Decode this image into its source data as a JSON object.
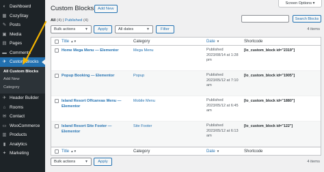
{
  "sidebar": {
    "items": [
      {
        "label": "Dashboard",
        "icon": "dashboard-icon",
        "glyph": "◐"
      },
      {
        "label": "CozyStay",
        "icon": "cozystay-icon",
        "glyph": "▦"
      },
      {
        "label": "Posts",
        "icon": "posts-icon",
        "glyph": "✎"
      },
      {
        "label": "Media",
        "icon": "media-icon",
        "glyph": "▣"
      },
      {
        "label": "Pages",
        "icon": "pages-icon",
        "glyph": "▤"
      },
      {
        "label": "Comments",
        "icon": "comments-icon",
        "glyph": "▬"
      },
      {
        "label": "Custom Blocks",
        "icon": "custom-blocks-icon",
        "glyph": "✈"
      }
    ],
    "submenu": [
      {
        "label": "All Custom Blocks"
      },
      {
        "label": "Add New"
      },
      {
        "label": "Category"
      }
    ],
    "items_after": [
      {
        "label": "Header Builder",
        "icon": "header-builder-icon",
        "glyph": "✈"
      },
      {
        "label": "Rooms",
        "icon": "rooms-icon",
        "glyph": "⌂"
      },
      {
        "label": "Contact",
        "icon": "contact-icon",
        "glyph": "✉"
      },
      {
        "label": "WooCommerce",
        "icon": "woocommerce-icon",
        "glyph": "▭"
      },
      {
        "label": "Products",
        "icon": "products-icon",
        "glyph": "▥"
      },
      {
        "label": "Analytics",
        "icon": "analytics-icon",
        "glyph": "▮"
      },
      {
        "label": "Marketing",
        "icon": "marketing-icon",
        "glyph": "✦"
      }
    ]
  },
  "header": {
    "screen_options": "Screen Options ▾",
    "title": "Custom Blocks",
    "add_new": "Add New"
  },
  "filters": {
    "all": "All",
    "all_count": "(4)",
    "sep": " | ",
    "published": "Published",
    "published_count": "(4)",
    "search_button": "Search Blocks",
    "bulk_actions": "Bulk actions",
    "apply": "Apply",
    "all_dates": "All dates",
    "filter": "Filter",
    "items_count": "4 items"
  },
  "table": {
    "headers": {
      "title": "Title",
      "category": "Category",
      "date": "Date",
      "shortcode": "Shortcode"
    },
    "rows": [
      {
        "title": "Home Mega Menu — Elementor",
        "category": "Mega Menu",
        "date_status": "Published",
        "date_value": "2023/08/14 at 1:28 pm",
        "shortcode": "[lo_custom_block id=\"2319\"]"
      },
      {
        "title": "Popup Booking — Elementor",
        "category": "Popup",
        "date_status": "Published",
        "date_value": "2023/05/12 at 7:10 am",
        "shortcode": "[lo_custom_block id=\"1905\"]"
      },
      {
        "title": "Island Resort Offcanvas Menu — Elementor",
        "category": "Mobile Menu",
        "date_status": "Published",
        "date_value": "2023/05/12 at 6:45 am",
        "shortcode": "[lo_custom_block id=\"1880\"]"
      },
      {
        "title": "Island Resort Site Footer — Elementor",
        "category": "Site Footer",
        "date_status": "Published",
        "date_value": "2023/05/12 at 6:13 am",
        "shortcode": "[lo_custom_block id=\"122\"]"
      }
    ]
  },
  "colors": {
    "sidebar": "#1d2327",
    "active": "#2271b1",
    "link": "#2271b1",
    "annotation": "#f5b400"
  }
}
